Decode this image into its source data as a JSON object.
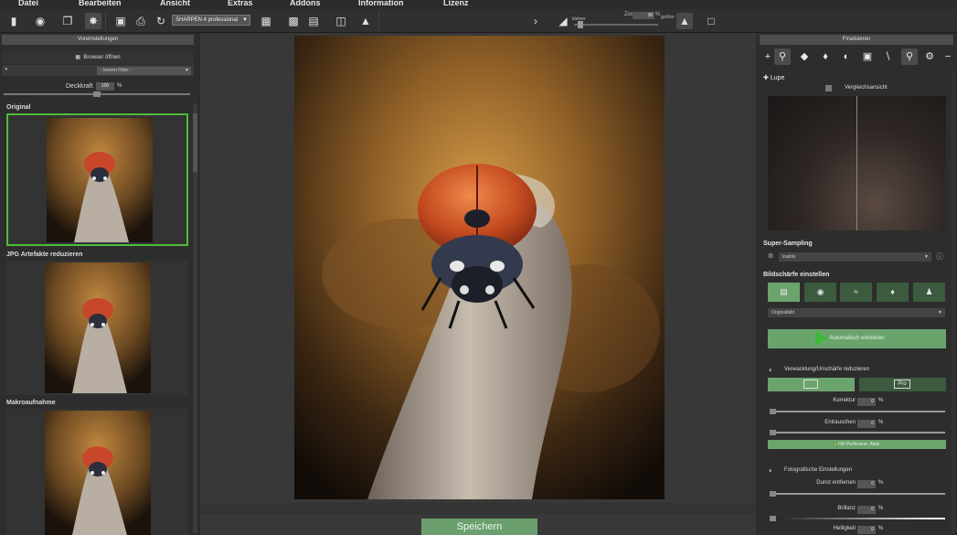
{
  "menu": [
    "Datei",
    "Bearbeiten",
    "Ansicht",
    "Extras",
    "Addons",
    "Information",
    "Lizenz"
  ],
  "toolbar": {
    "icons": [
      "new-file-icon",
      "camera-icon",
      "batch-icon",
      "magic-icon",
      "save-icon",
      "print-icon",
      "redo-icon"
    ],
    "preset_select": "SHARPEN 4 professional",
    "zoom": {
      "label": "Zoo",
      "value": "38",
      "percent": "%",
      "smaller_label": "kleiner",
      "bigger_label": "größer"
    }
  },
  "left_panel": {
    "title": "Voreinstellungen",
    "browser_button": "Browser öffnen",
    "filter_select": "- keinen Filter -",
    "opacity_label": "Deckkraft",
    "opacity_value": "100",
    "opacity_unit": "%",
    "presets": [
      {
        "label": "Original",
        "selected": true
      },
      {
        "label": "JPG Artefakte reduzieren",
        "selected": false
      },
      {
        "label": "Makroaufnahme",
        "selected": false
      }
    ]
  },
  "center": {
    "save_button": "Speichern"
  },
  "right_panel": {
    "title": "Finalisieren",
    "tool_icons": [
      "add-icon",
      "zoom-icon",
      "diamond-icon",
      "gem-icon",
      "contrast-icon",
      "image-icon",
      "brush-icon",
      "magnifier-icon",
      "gear-icon",
      "minus-icon"
    ],
    "lupe": {
      "title": "Lupe",
      "compare_label": "Vergleichsansicht"
    },
    "super_sampling": {
      "title": "Super-Sampling",
      "select": "Inaktiv"
    },
    "sharpness": {
      "title": "Bildschärfe einstellen",
      "select": "Originalbild",
      "auto_button": "Automatisch einstellen"
    },
    "blur_reduce": {
      "title": "Verwacklung/Unschärfe reduzieren",
      "pro_badge": "Pro",
      "sliders": [
        {
          "label": "Korrektur",
          "value": "0",
          "unit": "%"
        },
        {
          "label": "Entrauschen",
          "value": "0",
          "unit": "%"
        }
      ],
      "hd_label": "HD-Perfecteur: Aktiv"
    },
    "photo_settings": {
      "title": "Fotografische Einstellungen",
      "sliders": [
        {
          "label": "Dunst entfernen",
          "value": "0",
          "unit": "%"
        },
        {
          "label": "Brillanz",
          "value": "0",
          "unit": "%"
        },
        {
          "label": "Helligkeit",
          "value": "0",
          "unit": "%"
        }
      ]
    }
  },
  "colors": {
    "accent_green": "#6ba36d",
    "selection_green": "#4ebc3a",
    "panel_bg": "#2d2d2d"
  }
}
